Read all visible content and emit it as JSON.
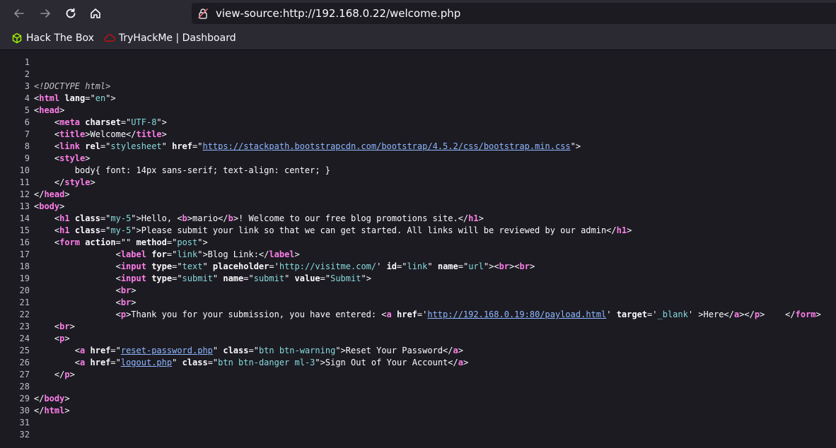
{
  "browser": {
    "url": "view-source:http://192.168.0.22/welcome.php",
    "bookmarks": [
      {
        "label": "Hack The Box"
      },
      {
        "label": "TryHackMe | Dashboard"
      }
    ]
  },
  "source": {
    "lines": [
      {
        "n": "1",
        "tokens": []
      },
      {
        "n": "2",
        "tokens": []
      },
      {
        "n": "3",
        "tokens": [
          {
            "t": "comment",
            "v": "<!DOCTYPE html>"
          }
        ]
      },
      {
        "n": "4",
        "tokens": [
          {
            "t": "plain",
            "v": "<"
          },
          {
            "t": "tag",
            "v": "html"
          },
          {
            "t": "plain",
            "v": " "
          },
          {
            "t": "attr",
            "v": "lang"
          },
          {
            "t": "plain",
            "v": "=\""
          },
          {
            "t": "val",
            "v": "en"
          },
          {
            "t": "plain",
            "v": "\">"
          }
        ]
      },
      {
        "n": "5",
        "tokens": [
          {
            "t": "plain",
            "v": "<"
          },
          {
            "t": "tag",
            "v": "head"
          },
          {
            "t": "plain",
            "v": ">"
          }
        ]
      },
      {
        "n": "6",
        "tokens": [
          {
            "t": "plain",
            "v": "    <"
          },
          {
            "t": "tag",
            "v": "meta"
          },
          {
            "t": "plain",
            "v": " "
          },
          {
            "t": "attr",
            "v": "charset"
          },
          {
            "t": "plain",
            "v": "=\""
          },
          {
            "t": "val",
            "v": "UTF-8"
          },
          {
            "t": "plain",
            "v": "\">"
          }
        ]
      },
      {
        "n": "7",
        "tokens": [
          {
            "t": "plain",
            "v": "    <"
          },
          {
            "t": "tag",
            "v": "title"
          },
          {
            "t": "plain",
            "v": ">Welcome</"
          },
          {
            "t": "tag",
            "v": "title"
          },
          {
            "t": "plain",
            "v": ">"
          }
        ]
      },
      {
        "n": "8",
        "tokens": [
          {
            "t": "plain",
            "v": "    <"
          },
          {
            "t": "tag",
            "v": "link"
          },
          {
            "t": "plain",
            "v": " "
          },
          {
            "t": "attr",
            "v": "rel"
          },
          {
            "t": "plain",
            "v": "=\""
          },
          {
            "t": "val",
            "v": "stylesheet"
          },
          {
            "t": "plain",
            "v": "\" "
          },
          {
            "t": "attr",
            "v": "href"
          },
          {
            "t": "plain",
            "v": "=\""
          },
          {
            "t": "link",
            "v": "https://stackpath.bootstrapcdn.com/bootstrap/4.5.2/css/bootstrap.min.css"
          },
          {
            "t": "plain",
            "v": "\">"
          }
        ]
      },
      {
        "n": "9",
        "tokens": [
          {
            "t": "plain",
            "v": "    <"
          },
          {
            "t": "tag",
            "v": "style"
          },
          {
            "t": "plain",
            "v": ">"
          }
        ]
      },
      {
        "n": "10",
        "tokens": [
          {
            "t": "plain",
            "v": "        body{ font: 14px sans-serif; text-align: center; }"
          }
        ]
      },
      {
        "n": "11",
        "tokens": [
          {
            "t": "plain",
            "v": "    </"
          },
          {
            "t": "tag",
            "v": "style"
          },
          {
            "t": "plain",
            "v": ">"
          }
        ]
      },
      {
        "n": "12",
        "tokens": [
          {
            "t": "plain",
            "v": "</"
          },
          {
            "t": "tag",
            "v": "head"
          },
          {
            "t": "plain",
            "v": ">"
          }
        ]
      },
      {
        "n": "13",
        "tokens": [
          {
            "t": "plain",
            "v": "<"
          },
          {
            "t": "tag",
            "v": "body"
          },
          {
            "t": "plain",
            "v": ">"
          }
        ]
      },
      {
        "n": "14",
        "tokens": [
          {
            "t": "plain",
            "v": "    <"
          },
          {
            "t": "tag",
            "v": "h1"
          },
          {
            "t": "plain",
            "v": " "
          },
          {
            "t": "attr",
            "v": "class"
          },
          {
            "t": "plain",
            "v": "=\""
          },
          {
            "t": "val",
            "v": "my-5"
          },
          {
            "t": "plain",
            "v": "\">Hello, <"
          },
          {
            "t": "tag",
            "v": "b"
          },
          {
            "t": "plain",
            "v": ">mario</"
          },
          {
            "t": "tag",
            "v": "b"
          },
          {
            "t": "plain",
            "v": ">! Welcome to our free blog promotions site.</"
          },
          {
            "t": "tag",
            "v": "h1"
          },
          {
            "t": "plain",
            "v": ">"
          }
        ]
      },
      {
        "n": "15",
        "tokens": [
          {
            "t": "plain",
            "v": "    <"
          },
          {
            "t": "tag",
            "v": "h1"
          },
          {
            "t": "plain",
            "v": " "
          },
          {
            "t": "attr",
            "v": "class"
          },
          {
            "t": "plain",
            "v": "=\""
          },
          {
            "t": "val",
            "v": "my-5"
          },
          {
            "t": "plain",
            "v": "\">Please submit your link so that we can get started. All links will be reviewed by our admin</"
          },
          {
            "t": "tag",
            "v": "h1"
          },
          {
            "t": "plain",
            "v": ">"
          }
        ]
      },
      {
        "n": "16",
        "tokens": [
          {
            "t": "plain",
            "v": "    <"
          },
          {
            "t": "tag",
            "v": "form"
          },
          {
            "t": "plain",
            "v": " "
          },
          {
            "t": "attr",
            "v": "action"
          },
          {
            "t": "plain",
            "v": "=\"\" "
          },
          {
            "t": "attr",
            "v": "method"
          },
          {
            "t": "plain",
            "v": "=\""
          },
          {
            "t": "val",
            "v": "post"
          },
          {
            "t": "plain",
            "v": "\">"
          }
        ]
      },
      {
        "n": "17",
        "tokens": [
          {
            "t": "plain",
            "v": "                <"
          },
          {
            "t": "tag",
            "v": "label"
          },
          {
            "t": "plain",
            "v": " "
          },
          {
            "t": "attr",
            "v": "for"
          },
          {
            "t": "plain",
            "v": "=\""
          },
          {
            "t": "val",
            "v": "link"
          },
          {
            "t": "plain",
            "v": "\">Blog Link:</"
          },
          {
            "t": "tag",
            "v": "label"
          },
          {
            "t": "plain",
            "v": ">"
          }
        ]
      },
      {
        "n": "18",
        "tokens": [
          {
            "t": "plain",
            "v": "                <"
          },
          {
            "t": "tag",
            "v": "input"
          },
          {
            "t": "plain",
            "v": " "
          },
          {
            "t": "attr",
            "v": "type"
          },
          {
            "t": "plain",
            "v": "=\""
          },
          {
            "t": "val",
            "v": "text"
          },
          {
            "t": "plain",
            "v": "\" "
          },
          {
            "t": "attr",
            "v": "placeholder"
          },
          {
            "t": "plain",
            "v": "='"
          },
          {
            "t": "val",
            "v": "http://visitme.com/"
          },
          {
            "t": "plain",
            "v": "' "
          },
          {
            "t": "attr",
            "v": "id"
          },
          {
            "t": "plain",
            "v": "=\""
          },
          {
            "t": "val",
            "v": "link"
          },
          {
            "t": "plain",
            "v": "\" "
          },
          {
            "t": "attr",
            "v": "name"
          },
          {
            "t": "plain",
            "v": "=\""
          },
          {
            "t": "val",
            "v": "url"
          },
          {
            "t": "plain",
            "v": "\"><"
          },
          {
            "t": "tag",
            "v": "br"
          },
          {
            "t": "plain",
            "v": "><"
          },
          {
            "t": "tag",
            "v": "br"
          },
          {
            "t": "plain",
            "v": ">"
          }
        ]
      },
      {
        "n": "19",
        "tokens": [
          {
            "t": "plain",
            "v": "                <"
          },
          {
            "t": "tag",
            "v": "input"
          },
          {
            "t": "plain",
            "v": " "
          },
          {
            "t": "attr",
            "v": "type"
          },
          {
            "t": "plain",
            "v": "=\""
          },
          {
            "t": "val",
            "v": "submit"
          },
          {
            "t": "plain",
            "v": "\" "
          },
          {
            "t": "attr",
            "v": "name"
          },
          {
            "t": "plain",
            "v": "=\""
          },
          {
            "t": "val",
            "v": "submit"
          },
          {
            "t": "plain",
            "v": "\" "
          },
          {
            "t": "attr",
            "v": "value"
          },
          {
            "t": "plain",
            "v": "=\""
          },
          {
            "t": "val",
            "v": "Submit"
          },
          {
            "t": "plain",
            "v": "\">"
          }
        ]
      },
      {
        "n": "20",
        "tokens": [
          {
            "t": "plain",
            "v": "                <"
          },
          {
            "t": "tag",
            "v": "br"
          },
          {
            "t": "plain",
            "v": ">"
          }
        ]
      },
      {
        "n": "21",
        "tokens": [
          {
            "t": "plain",
            "v": "                <"
          },
          {
            "t": "tag",
            "v": "br"
          },
          {
            "t": "plain",
            "v": ">"
          }
        ]
      },
      {
        "n": "22",
        "tokens": [
          {
            "t": "plain",
            "v": "                <"
          },
          {
            "t": "tag",
            "v": "p"
          },
          {
            "t": "plain",
            "v": ">Thank you for your submission, you have entered: <"
          },
          {
            "t": "tag",
            "v": "a"
          },
          {
            "t": "plain",
            "v": " "
          },
          {
            "t": "attr",
            "v": "href"
          },
          {
            "t": "plain",
            "v": "='"
          },
          {
            "t": "link",
            "v": "http://192.168.0.19:80/payload.html"
          },
          {
            "t": "plain",
            "v": "' "
          },
          {
            "t": "attr",
            "v": "target"
          },
          {
            "t": "plain",
            "v": "='"
          },
          {
            "t": "val",
            "v": "_blank"
          },
          {
            "t": "plain",
            "v": "' >Here</"
          },
          {
            "t": "tag",
            "v": "a"
          },
          {
            "t": "plain",
            "v": "></"
          },
          {
            "t": "tag",
            "v": "p"
          },
          {
            "t": "plain",
            "v": ">    </"
          },
          {
            "t": "tag",
            "v": "form"
          },
          {
            "t": "plain",
            "v": ">"
          }
        ]
      },
      {
        "n": "23",
        "tokens": [
          {
            "t": "plain",
            "v": "    <"
          },
          {
            "t": "tag",
            "v": "br"
          },
          {
            "t": "plain",
            "v": ">"
          }
        ]
      },
      {
        "n": "24",
        "tokens": [
          {
            "t": "plain",
            "v": "    <"
          },
          {
            "t": "tag",
            "v": "p"
          },
          {
            "t": "plain",
            "v": ">"
          }
        ]
      },
      {
        "n": "25",
        "tokens": [
          {
            "t": "plain",
            "v": "        <"
          },
          {
            "t": "tag",
            "v": "a"
          },
          {
            "t": "plain",
            "v": " "
          },
          {
            "t": "attr",
            "v": "href"
          },
          {
            "t": "plain",
            "v": "=\""
          },
          {
            "t": "link",
            "v": "reset-password.php"
          },
          {
            "t": "plain",
            "v": "\" "
          },
          {
            "t": "attr",
            "v": "class"
          },
          {
            "t": "plain",
            "v": "=\""
          },
          {
            "t": "val",
            "v": "btn btn-warning"
          },
          {
            "t": "plain",
            "v": "\">Reset Your Password</"
          },
          {
            "t": "tag",
            "v": "a"
          },
          {
            "t": "plain",
            "v": ">"
          }
        ]
      },
      {
        "n": "26",
        "tokens": [
          {
            "t": "plain",
            "v": "        <"
          },
          {
            "t": "tag",
            "v": "a"
          },
          {
            "t": "plain",
            "v": " "
          },
          {
            "t": "attr",
            "v": "href"
          },
          {
            "t": "plain",
            "v": "=\""
          },
          {
            "t": "link",
            "v": "logout.php"
          },
          {
            "t": "plain",
            "v": "\" "
          },
          {
            "t": "attr",
            "v": "class"
          },
          {
            "t": "plain",
            "v": "=\""
          },
          {
            "t": "val",
            "v": "btn btn-danger ml-3"
          },
          {
            "t": "plain",
            "v": "\">Sign Out of Your Account</"
          },
          {
            "t": "tag",
            "v": "a"
          },
          {
            "t": "plain",
            "v": ">"
          }
        ]
      },
      {
        "n": "27",
        "tokens": [
          {
            "t": "plain",
            "v": "    </"
          },
          {
            "t": "tag",
            "v": "p"
          },
          {
            "t": "plain",
            "v": ">"
          }
        ]
      },
      {
        "n": "28",
        "tokens": []
      },
      {
        "n": "29",
        "tokens": [
          {
            "t": "plain",
            "v": "</"
          },
          {
            "t": "tag",
            "v": "body"
          },
          {
            "t": "plain",
            "v": ">"
          }
        ]
      },
      {
        "n": "30",
        "tokens": [
          {
            "t": "plain",
            "v": "</"
          },
          {
            "t": "tag",
            "v": "html"
          },
          {
            "t": "plain",
            "v": ">"
          }
        ]
      },
      {
        "n": "31",
        "tokens": []
      },
      {
        "n": "32",
        "tokens": []
      }
    ]
  }
}
